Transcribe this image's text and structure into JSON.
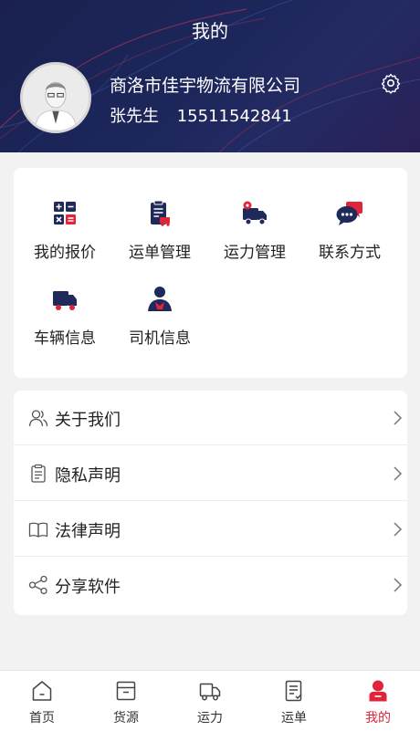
{
  "header": {
    "title": "我的",
    "company": "商洛市佳宇物流有限公司",
    "user_name": "张先生",
    "phone": "15511542841"
  },
  "functions": [
    {
      "label": "我的报价",
      "icon": "calculator-icon"
    },
    {
      "label": "运单管理",
      "icon": "waybill-clipboard-icon"
    },
    {
      "label": "运力管理",
      "icon": "truck-gear-icon"
    },
    {
      "label": "联系方式",
      "icon": "chat-bubbles-icon"
    },
    {
      "label": "车辆信息",
      "icon": "truck-icon"
    },
    {
      "label": "司机信息",
      "icon": "driver-icon"
    }
  ],
  "menu": [
    {
      "label": "关于我们",
      "icon": "people-icon"
    },
    {
      "label": "隐私声明",
      "icon": "clipboard-icon"
    },
    {
      "label": "法律声明",
      "icon": "book-icon"
    },
    {
      "label": "分享软件",
      "icon": "share-icon"
    }
  ],
  "tabs": [
    {
      "label": "首页",
      "icon": "home-icon",
      "active": false
    },
    {
      "label": "货源",
      "icon": "box-icon",
      "active": false
    },
    {
      "label": "运力",
      "icon": "truck-outline-icon",
      "active": false
    },
    {
      "label": "运单",
      "icon": "document-icon",
      "active": false
    },
    {
      "label": "我的",
      "icon": "person-icon",
      "active": true
    }
  ],
  "colors": {
    "header_bg": "#1c2659",
    "icon_dark": "#1f2a5a",
    "accent_red": "#e0243a"
  }
}
